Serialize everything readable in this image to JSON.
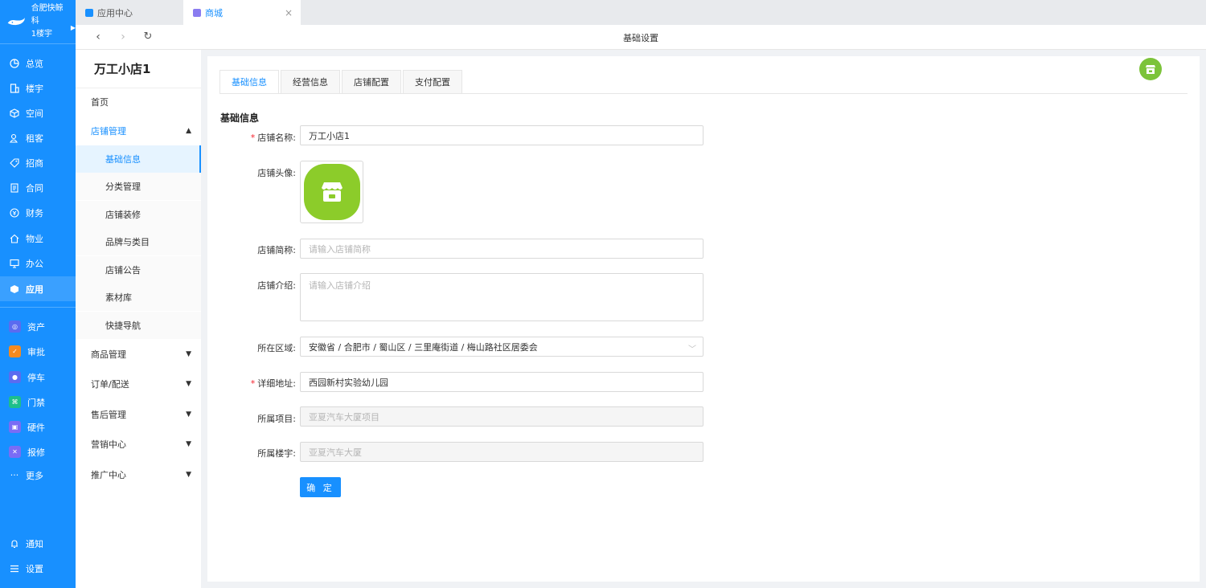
{
  "brand": {
    "name": "合肥快鲸科",
    "building": "1楼宇"
  },
  "rail": {
    "main": [
      {
        "label": "总览",
        "icon": "dashboard-icon"
      },
      {
        "label": "楼宇",
        "icon": "building-icon"
      },
      {
        "label": "空间",
        "icon": "cube-icon"
      },
      {
        "label": "租客",
        "icon": "tenant-icon"
      },
      {
        "label": "招商",
        "icon": "tag-icon"
      },
      {
        "label": "合同",
        "icon": "contract-icon"
      },
      {
        "label": "财务",
        "icon": "finance-icon"
      },
      {
        "label": "物业",
        "icon": "home-icon"
      },
      {
        "label": "办公",
        "icon": "monitor-icon"
      },
      {
        "label": "应用",
        "icon": "app-icon"
      }
    ],
    "apps": [
      {
        "label": "资产",
        "color": "#5b6bf0"
      },
      {
        "label": "审批",
        "color": "#f58a1f"
      },
      {
        "label": "停车",
        "color": "#5b6bf0"
      },
      {
        "label": "门禁",
        "color": "#1dbf8a"
      },
      {
        "label": "硬件",
        "color": "#7a6cf5"
      },
      {
        "label": "报修",
        "color": "#7a6cf5"
      }
    ],
    "more": "更多",
    "notify": "通知",
    "settings": "设置"
  },
  "tabs": [
    {
      "label": "应用中心",
      "color": "#1890ff"
    },
    {
      "label": "商城",
      "color": "#8a7cf0"
    }
  ],
  "toolbar": {
    "title": "基础设置"
  },
  "subnav": {
    "store_title": "万工小店1",
    "home": "首页",
    "store_mgmt": "店铺管理",
    "store_children": [
      "基础信息",
      "分类管理",
      "店铺装修",
      "品牌与类目",
      "店铺公告",
      "素材库",
      "快捷导航"
    ],
    "groups": [
      "商品管理",
      "订单/配送",
      "售后管理",
      "营销中心",
      "推广中心"
    ]
  },
  "content": {
    "tabs": [
      "基础信息",
      "经营信息",
      "店铺配置",
      "支付配置"
    ],
    "section_title": "基础信息",
    "form": {
      "name_label": "店铺名称:",
      "name_value": "万工小店1",
      "avatar_label": "店铺头像:",
      "short_label": "店铺简称:",
      "short_placeholder": "请输入店铺简称",
      "intro_label": "店铺介绍:",
      "intro_placeholder": "请输入店铺介绍",
      "region_label": "所在区域:",
      "region_value": "安徽省 / 合肥市 / 蜀山区 / 三里庵街道 / 梅山路社区居委会",
      "address_label": "详细地址:",
      "address_value": "西园新村实验幼儿园",
      "project_label": "所属项目:",
      "project_value": "亚夏汽车大厦项目",
      "building_label": "所属楼宇:",
      "building_value": "亚夏汽车大厦",
      "submit": "确 定"
    }
  },
  "colors": {
    "primary": "#1890ff",
    "accent_green": "#7cc33a"
  }
}
